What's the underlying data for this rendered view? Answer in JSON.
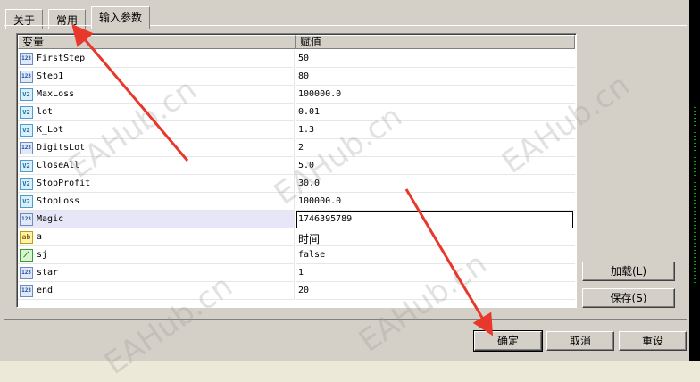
{
  "tabs": [
    {
      "label": "关于"
    },
    {
      "label": "常用"
    },
    {
      "label": "输入参数"
    }
  ],
  "grid": {
    "col_variable": "变量",
    "col_value": "赋值",
    "rows": [
      {
        "icon": "123",
        "name": "FirstStep",
        "value": "50"
      },
      {
        "icon": "123",
        "name": "Step1",
        "value": "80"
      },
      {
        "icon": "V2",
        "name": "MaxLoss",
        "value": "100000.0"
      },
      {
        "icon": "V2",
        "name": "lot",
        "value": "0.01"
      },
      {
        "icon": "V2",
        "name": "K_Lot",
        "value": "1.3"
      },
      {
        "icon": "123",
        "name": "DigitsLot",
        "value": "2"
      },
      {
        "icon": "V2",
        "name": "CloseAll",
        "value": "5.0"
      },
      {
        "icon": "V2",
        "name": "StopProfit",
        "value": "30.0"
      },
      {
        "icon": "V2",
        "name": "StopLoss",
        "value": "100000.0"
      },
      {
        "icon": "123",
        "name": "Magic",
        "value": "1746395789"
      },
      {
        "icon": "ab",
        "name": "a",
        "value": "时间"
      },
      {
        "icon": "bool",
        "name": "sj",
        "value": "false"
      },
      {
        "icon": "123",
        "name": "star",
        "value": "1"
      },
      {
        "icon": "123",
        "name": "end",
        "value": "20"
      }
    ]
  },
  "buttons": {
    "load": "加载(L)",
    "save": "保存(S)",
    "ok": "确定",
    "cancel": "取消",
    "reset": "重设"
  },
  "watermark": "EAHub.cn",
  "colors": {
    "arrow": "#e8372b",
    "selected_row": "#e6e6f8"
  }
}
